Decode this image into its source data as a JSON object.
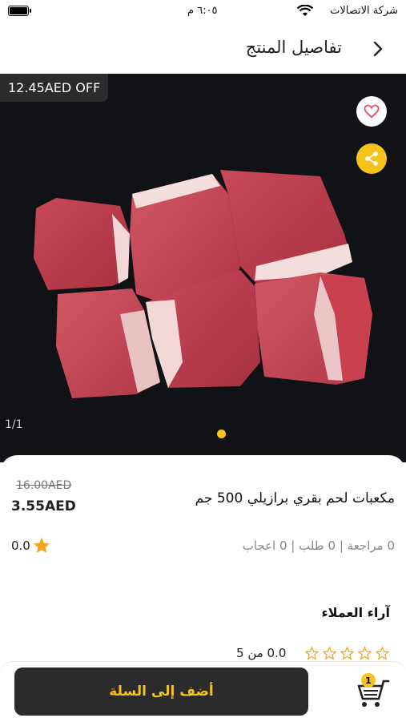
{
  "status_bar": {
    "carrier": "شركة الاتصالات",
    "time": "٦:٠٥ م"
  },
  "header": {
    "title": "تفاصيل المنتج"
  },
  "hero": {
    "discount": "12.45AED OFF",
    "image_counter": "1/1"
  },
  "product": {
    "name": "مكعبات لحم بقري برازيلي 500 جم",
    "old_price": "16.00AED",
    "price": "3.55AED",
    "stats": "0 مراجعة | 0 طلب | 0 اعجاب",
    "rating": "0.0"
  },
  "reviews": {
    "title": "آراء العملاء",
    "rating_text": "0.0 من 5"
  },
  "bottom_bar": {
    "add_to_cart": "أضف إلى السلة",
    "cart_count": "1"
  },
  "colors": {
    "accent": "#f5c31c",
    "dark": "#2b2a2c",
    "favorite": "#e0505b"
  }
}
